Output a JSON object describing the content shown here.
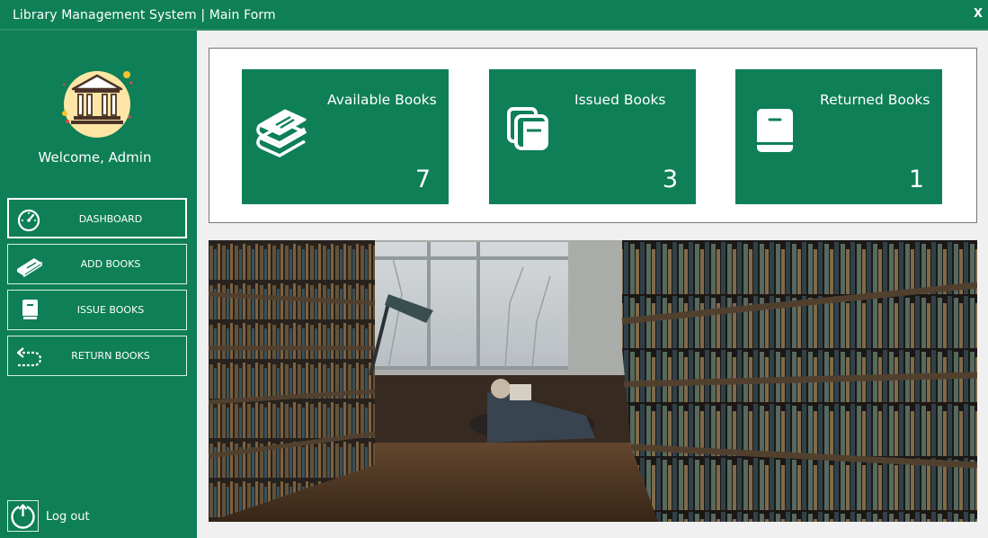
{
  "window": {
    "title": "Library Management System | Main Form",
    "close_label": "X"
  },
  "sidebar": {
    "welcome": "Welcome, Admin",
    "nav": [
      {
        "label": "DASHBOARD",
        "icon": "speedometer-icon",
        "active": true
      },
      {
        "label": "ADD BOOKS",
        "icon": "books-icon",
        "active": false
      },
      {
        "label": "ISSUE BOOKS",
        "icon": "book-icon",
        "active": false
      },
      {
        "label": "RETURN BOOKS",
        "icon": "return-arrow-icon",
        "active": false
      }
    ],
    "logout_label": "Log out",
    "logout_icon": "power-icon"
  },
  "stats": [
    {
      "label": "Available Books",
      "value": "7",
      "icon": "stacked-books-icon"
    },
    {
      "label": "Issued Books",
      "value": "3",
      "icon": "copy-books-icon"
    },
    {
      "label": "Returned Books",
      "value": "1",
      "icon": "closed-book-icon"
    }
  ],
  "colors": {
    "primary": "#0e7f56",
    "background": "#f0f0f0",
    "panel": "#ffffff",
    "text_on_primary": "#ffffff"
  }
}
